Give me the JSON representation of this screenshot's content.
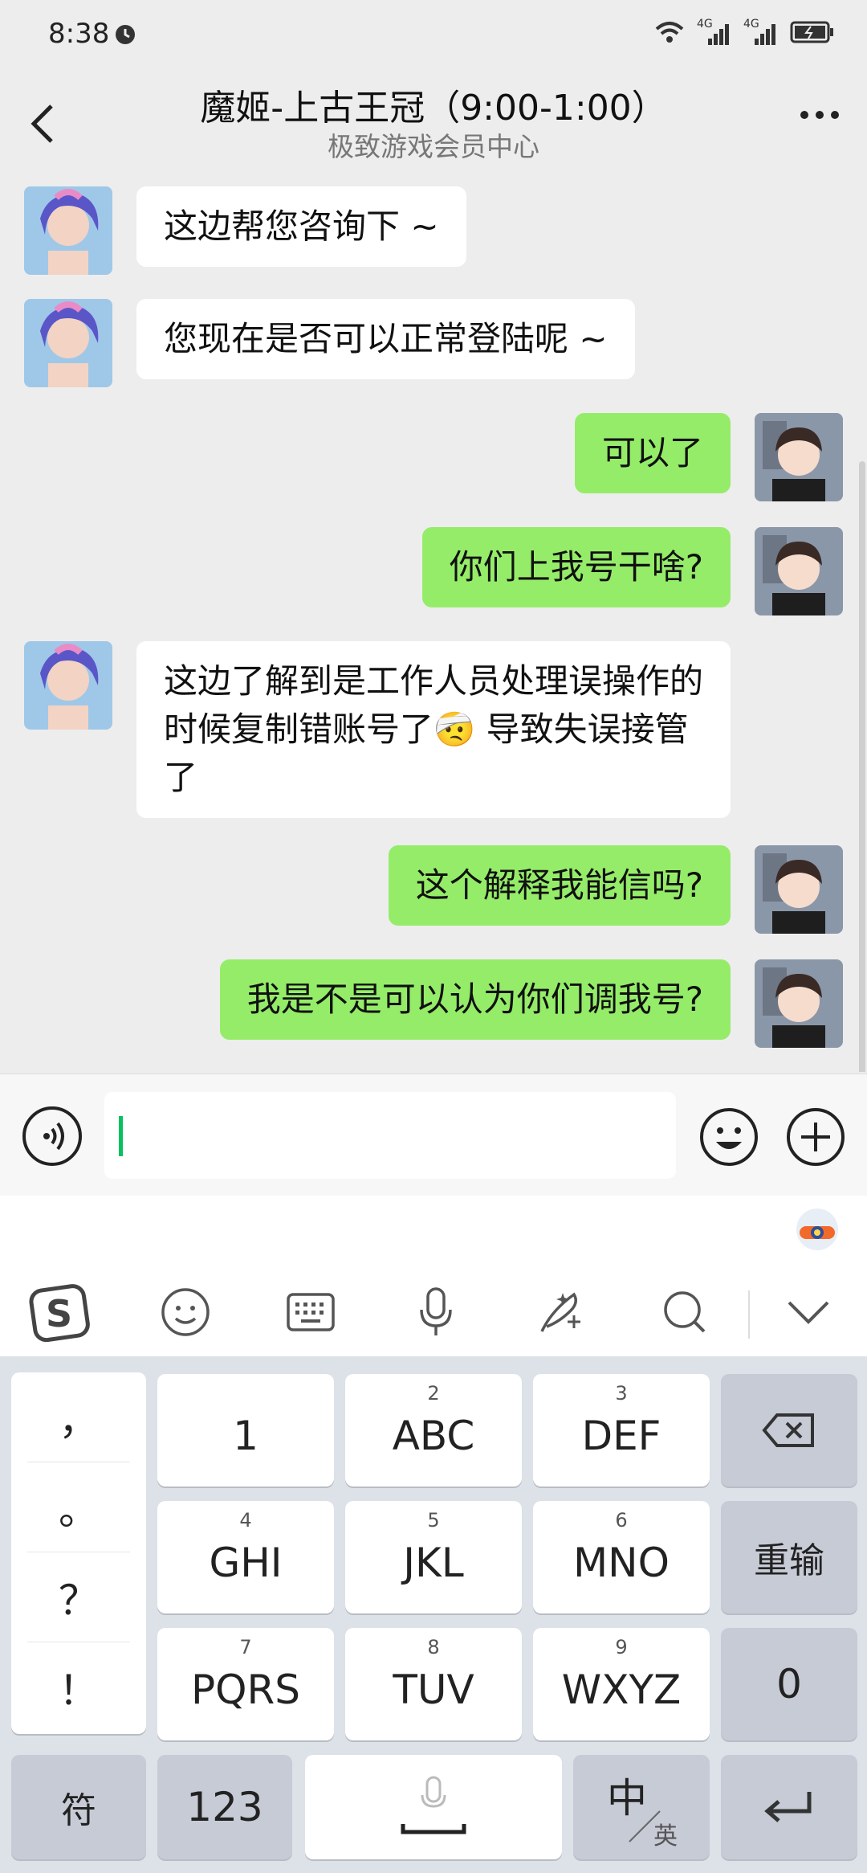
{
  "status": {
    "time": "8:38",
    "network1": "4G",
    "network2": "4G"
  },
  "header": {
    "title": "魔姬-上古王冠（9:00-1:00）",
    "subtitle": "极致游戏会员中心"
  },
  "messages": [
    {
      "side": "left",
      "text": "这边帮您咨询下 ~"
    },
    {
      "side": "left",
      "text": "您现在是否可以正常登陆呢 ~"
    },
    {
      "side": "right",
      "text": "可以了"
    },
    {
      "side": "right",
      "text": "你们上我号干啥?"
    },
    {
      "side": "left",
      "text": "这边了解到是工作人员处理误操作的时候复制错账号了🤕 导致失误接管了"
    },
    {
      "side": "right",
      "text": "这个解释我能信吗?"
    },
    {
      "side": "right",
      "text": "我是不是可以认为你们调我号?"
    }
  ],
  "input": {
    "value": ""
  },
  "keyboard": {
    "punctuation": [
      "，",
      "。",
      "？",
      "！"
    ],
    "keys": [
      {
        "num": "",
        "label": "1"
      },
      {
        "num": "2",
        "label": "ABC"
      },
      {
        "num": "3",
        "label": "DEF"
      },
      {
        "num": "4",
        "label": "GHI"
      },
      {
        "num": "5",
        "label": "JKL"
      },
      {
        "num": "6",
        "label": "MNO"
      },
      {
        "num": "7",
        "label": "PQRS"
      },
      {
        "num": "8",
        "label": "TUV"
      },
      {
        "num": "9",
        "label": "WXYZ"
      }
    ],
    "reenter": "重输",
    "zero": "0",
    "symbol": "符",
    "numbers": "123",
    "lang_main": "中",
    "lang_sub": "英"
  },
  "colors": {
    "bubble_right": "#95ec69",
    "bubble_left": "#ffffff",
    "cursor": "#07c160",
    "background": "#ededed"
  }
}
